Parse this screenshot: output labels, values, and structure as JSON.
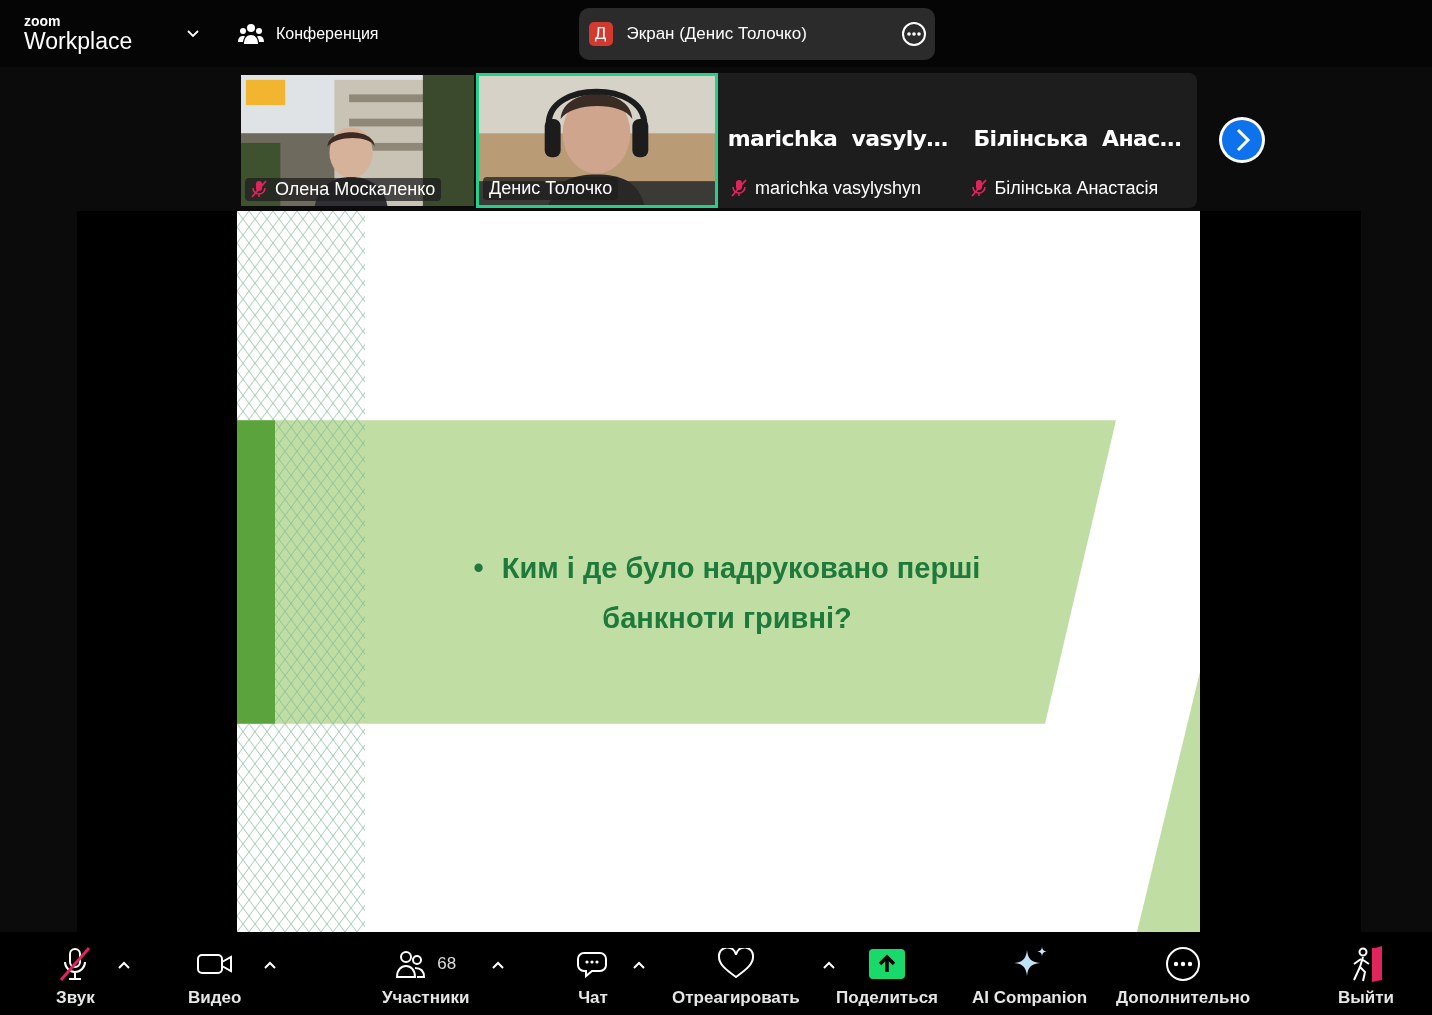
{
  "top_bar": {
    "logo": {
      "brand": "zoom",
      "product": "Workplace"
    },
    "meeting_label": "Конференция",
    "share_indicator": {
      "initial": "Д",
      "label": "Экран (Денис Толочко)"
    }
  },
  "participants": [
    {
      "kind": "video",
      "name": "Олена Москаленко",
      "muted": true,
      "selected": false
    },
    {
      "kind": "video",
      "name": "Денис Толочко",
      "muted": false,
      "selected": true
    },
    {
      "kind": "name",
      "display": "marichka  vasyly…",
      "name": "marichka vasylyshyn",
      "muted": true,
      "selected": false
    },
    {
      "kind": "name",
      "display": "Білінська  Анас…",
      "name": "Білінська Анастасія",
      "muted": true,
      "selected": false
    }
  ],
  "slide": {
    "bullet": "•",
    "text": "Ким і де було надруковано перші банкноти гривні?"
  },
  "toolbar": [
    {
      "kind": "audio",
      "label": "Звук",
      "muted": true,
      "caret": true
    },
    {
      "kind": "video",
      "label": "Видео",
      "caret": true
    },
    {
      "kind": "participants",
      "label": "Участники",
      "count": "68",
      "caret": true
    },
    {
      "kind": "chat",
      "label": "Чат",
      "caret": true
    },
    {
      "kind": "react",
      "label": "Отреагировать",
      "caret": true
    },
    {
      "kind": "share",
      "label": "Поделиться",
      "caret": false
    },
    {
      "kind": "ai",
      "label": "AI Companion",
      "caret": false
    },
    {
      "kind": "more",
      "label": "Дополнительно",
      "caret": false
    },
    {
      "kind": "leave",
      "label": "Выйти",
      "caret": false
    }
  ]
}
